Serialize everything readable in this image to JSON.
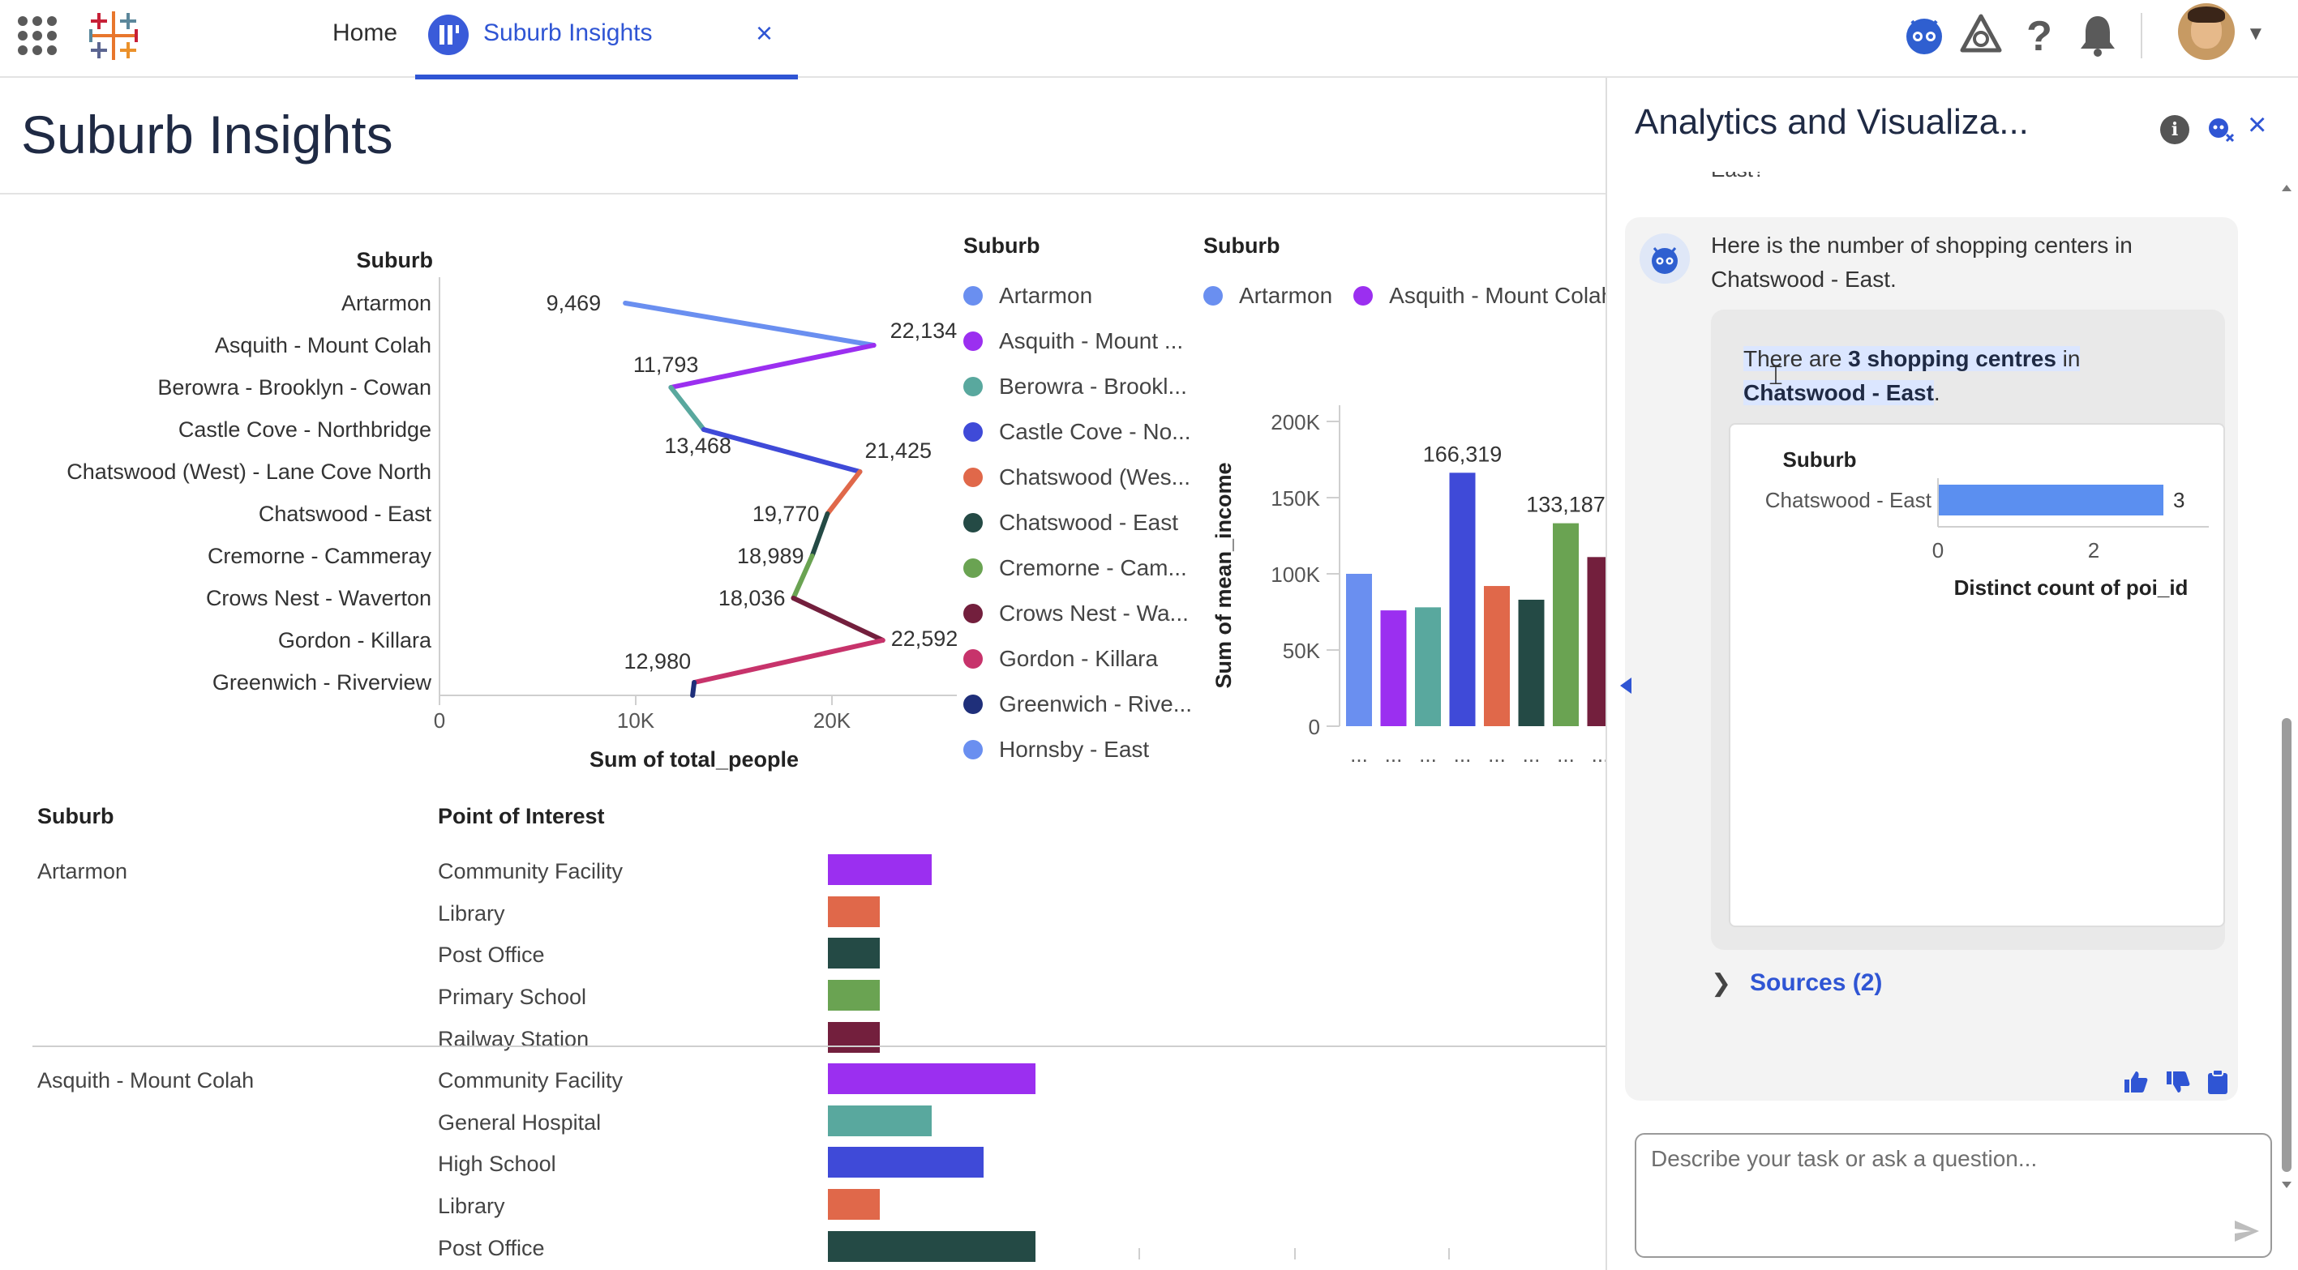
{
  "nav": {
    "home_label": "Home",
    "active_tab_label": "Suburb Insights",
    "close_glyph": "×",
    "icons": [
      "app-launcher-icon",
      "tableau-logo-icon",
      "einstein-agent-icon",
      "setup-icon",
      "help-icon",
      "notifications-icon",
      "user-avatar"
    ]
  },
  "page": {
    "title": "Suburb Insights"
  },
  "line_chart": {
    "header": "Suburb",
    "suburbs": [
      "Artarmon",
      "Asquith - Mount Colah",
      "Berowra - Brooklyn - Cowan",
      "Castle Cove - Northbridge",
      "Chatswood (West) - Lane Cove North",
      "Chatswood - East",
      "Cremorne - Cammeray",
      "Crows Nest - Waverton",
      "Gordon - Killara",
      "Greenwich - Riverview"
    ],
    "value_labels": [
      "9,469",
      "22,134",
      "11,793",
      "13,468",
      "21,425",
      "19,770",
      "18,989",
      "18,036",
      "22,592",
      "12,980"
    ],
    "x_ticks": [
      "0",
      "10K",
      "20K"
    ],
    "xlabel": "Sum of total_people"
  },
  "legend_line": {
    "title": "Suburb",
    "items": [
      {
        "label": "Artarmon",
        "color": "#6a8ff0"
      },
      {
        "label": "Asquith - Mount ...",
        "color": "#9b2ff0"
      },
      {
        "label": "Berowra - Brookl...",
        "color": "#59a89e"
      },
      {
        "label": "Castle Cove - No...",
        "color": "#3f4ad8"
      },
      {
        "label": "Chatswood (Wes...",
        "color": "#e0684a"
      },
      {
        "label": "Chatswood - East",
        "color": "#244a45"
      },
      {
        "label": "Cremorne - Cam...",
        "color": "#6aa352"
      },
      {
        "label": "Crows Nest - Wa...",
        "color": "#731f3d"
      },
      {
        "label": "Gordon - Killara",
        "color": "#c7336b"
      },
      {
        "label": "Greenwich - Rive...",
        "color": "#1f2f7a"
      },
      {
        "label": "Hornsby - East",
        "color": "#6a8ff0"
      }
    ]
  },
  "legend_bar": {
    "title": "Suburb",
    "items": [
      {
        "label": "Artarmon",
        "color": "#6a8ff0"
      },
      {
        "label": "Asquith - Mount Colah",
        "color": "#9b2ff0"
      }
    ]
  },
  "bar_chart": {
    "ylabel": "Sum of mean_income",
    "y_ticks": [
      "200K",
      "150K",
      "100K",
      "50K",
      "0"
    ],
    "value_labels": [
      "166,319",
      "133,187"
    ],
    "x_tick_label": "..."
  },
  "poi_table": {
    "col_suburb": "Suburb",
    "col_poi": "Point of Interest",
    "groups": [
      {
        "suburb": "Artarmon",
        "rows": [
          {
            "poi": "Community Facility",
            "color": "#9b2ff0"
          },
          {
            "poi": "Library",
            "color": "#e0684a"
          },
          {
            "poi": "Post Office",
            "color": "#244a45"
          },
          {
            "poi": "Primary School",
            "color": "#6aa352"
          },
          {
            "poi": "Railway Station",
            "color": "#731f3d"
          }
        ]
      },
      {
        "suburb": "Asquith - Mount Colah",
        "rows": [
          {
            "poi": "Community Facility",
            "color": "#9b2ff0"
          },
          {
            "poi": "General Hospital",
            "color": "#59a89e"
          },
          {
            "poi": "High School",
            "color": "#3f4ad8"
          },
          {
            "poi": "Library",
            "color": "#e0684a"
          },
          {
            "poi": "Post Office",
            "color": "#244a45"
          }
        ]
      }
    ]
  },
  "chart_data": [
    {
      "type": "line",
      "title": "",
      "xlabel": "Sum of total_people",
      "ylabel": "Suburb",
      "xlim": [
        0,
        26000
      ],
      "categories": [
        "Artarmon",
        "Asquith - Mount Colah",
        "Berowra - Brooklyn - Cowan",
        "Castle Cove - Northbridge",
        "Chatswood (West) - Lane Cove North",
        "Chatswood - East",
        "Cremorne - Cammeray",
        "Crows Nest - Waverton",
        "Gordon - Killara",
        "Greenwich - Riverview"
      ],
      "values": [
        9469,
        22134,
        11793,
        13468,
        21425,
        19770,
        18989,
        18036,
        22592,
        12980
      ],
      "x_ticks": [
        "0",
        "10K",
        "20K"
      ]
    },
    {
      "type": "bar",
      "title": "",
      "xlabel": "",
      "ylabel": "Sum of mean_income",
      "ylim": [
        0,
        200000
      ],
      "legend": "Suburb",
      "categories": [
        "Artarmon",
        "Asquith - Mount Colah",
        "Berowra - Brooklyn - Cowan",
        "Castle Cove - Northbridge",
        "Chatswood (West) - Lane Cove North",
        "Chatswood - East",
        "Cremorne - Cammeray",
        "Crows Nest - Waverton"
      ],
      "values": [
        100000,
        76000,
        78000,
        166319,
        92000,
        83000,
        133187,
        111000
      ],
      "colors": [
        "#6a8ff0",
        "#9b2ff0",
        "#59a89e",
        "#3f4ad8",
        "#e0684a",
        "#244a45",
        "#6aa352",
        "#731f3d"
      ]
    },
    {
      "type": "bar",
      "title": "",
      "xlabel": "",
      "ylabel": "Point of Interest",
      "categories": [
        "Artarmon / Community Facility",
        "Artarmon / Library",
        "Artarmon / Post Office",
        "Artarmon / Primary School",
        "Artarmon / Railway Station",
        "Asquith - Mount Colah / Community Facility",
        "Asquith - Mount Colah / General Hospital",
        "Asquith - Mount Colah / High School",
        "Asquith - Mount Colah / Library",
        "Asquith - Mount Colah / Post Office"
      ],
      "values": [
        2,
        1,
        1,
        1,
        1,
        4,
        2,
        3,
        1,
        4
      ]
    },
    {
      "type": "bar",
      "title": "",
      "orientation": "horizontal",
      "ylabel": "Suburb",
      "xlabel": "Distinct count of poi_id",
      "categories": [
        "Chatswood - East"
      ],
      "values": [
        3
      ],
      "xlim": [
        0,
        3.5
      ],
      "x_ticks": [
        "0",
        "2"
      ],
      "color": "#5b8ff0"
    }
  ],
  "assistant": {
    "title": "Analytics and Visualiza...",
    "previous_question_tail": "East?",
    "bot_message": "Here is the number of shopping centers in Chatswood - East.",
    "answer_prefix": "There are ",
    "answer_bold": "3 shopping centres",
    "answer_mid": " in ",
    "answer_bold2": "Chatswood - East",
    "answer_suffix": ".",
    "mini_chart": {
      "header": "Suburb",
      "category": "Chatswood - East",
      "value_label": "3",
      "x_ticks": [
        "0",
        "2"
      ],
      "xlabel": "Distinct count of poi_id"
    },
    "sources_label": "Sources (2)",
    "input_placeholder": "Describe your task or ask a question...",
    "info_glyph": "i",
    "close_glyph": "×"
  }
}
